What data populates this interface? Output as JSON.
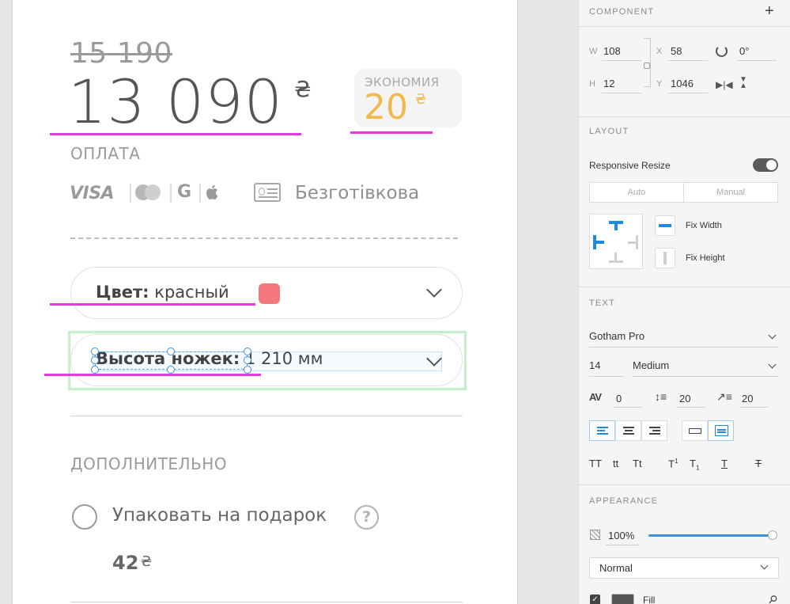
{
  "product": {
    "old_price": "15 190",
    "price": "13 090",
    "currency": "₴",
    "savings_label": "ЭКОНОМИЯ",
    "savings_value": "20",
    "payment_label": "ОПЛАТА",
    "payment_icons": [
      "VISA",
      "mastercard-icon",
      "google-pay-icon",
      "apple-pay-icon"
    ],
    "cashless_label": "Безготівкова",
    "color_field": {
      "label": "Цвет:",
      "value": "красный",
      "swatch_color": "#f4787b"
    },
    "knife_field": {
      "label": "Высота ножек:",
      "value": "1 210 мм"
    },
    "extra_label": "ДОПОЛНИТЕЛЬНО",
    "gift_option": {
      "label": "Упаковать на подарок",
      "help": "?",
      "price": "42"
    }
  },
  "accent_colors": {
    "savings": "#f3b84c",
    "annotation": "#e83adb",
    "selection": "#3d8fe0",
    "highlight_green": "#c5efca"
  },
  "inspector": {
    "component": {
      "title": "COMPONENT",
      "add": "+"
    },
    "dimensions": {
      "w_label": "W",
      "w": "108",
      "h_label": "H",
      "h": "12",
      "x_label": "X",
      "x": "58",
      "y_label": "Y",
      "y": "1046",
      "rotation": "0°"
    },
    "layout": {
      "title": "LAYOUT",
      "responsive_resize": "Responsive Resize",
      "responsive_on": true,
      "auto": "Auto",
      "manual": "Manual",
      "fix_width": "Fix Width",
      "fix_height": "Fix Height"
    },
    "text": {
      "title": "TEXT",
      "font_family": "Gotham Pro",
      "font_size": "14",
      "font_weight": "Medium",
      "char_spacing_icon": "AV",
      "char_spacing": "0",
      "line_spacing": "20",
      "paragraph_spacing": "20",
      "transforms": [
        "TT",
        "tt",
        "Tt"
      ],
      "super": "T",
      "super_mark": "1",
      "sub": "T",
      "sub_mark": "1",
      "underline": "T",
      "strike": "T"
    },
    "appearance": {
      "title": "APPEARANCE",
      "opacity": "100%",
      "opacity_value": 1.0,
      "blend_mode": "Normal",
      "fill_label": "Fill",
      "fill_enabled": true,
      "fill_color": "#555555"
    }
  }
}
